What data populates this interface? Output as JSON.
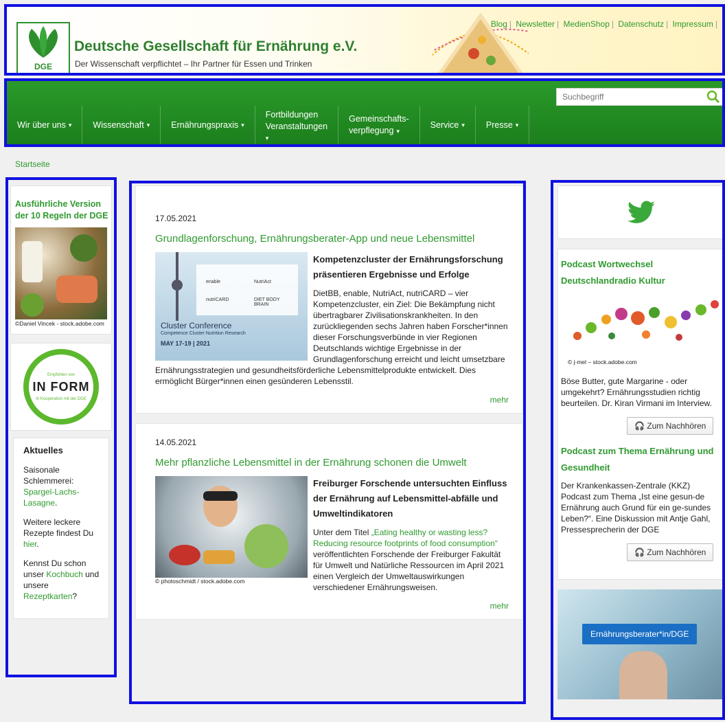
{
  "header": {
    "logo_text": "DGE",
    "title": "Deutsche Gesellschaft für Ernährung e.V.",
    "subtitle": "Der Wissenschaft verpflichtet – Ihr Partner für Essen und Trinken",
    "toplinks": [
      "Blog",
      "Newsletter",
      "MedienShop",
      "Datenschutz",
      "Impressum"
    ]
  },
  "nav": {
    "items": [
      {
        "l1": "Wir über uns",
        "l2": ""
      },
      {
        "l1": "Wissenschaft",
        "l2": ""
      },
      {
        "l1": "Ernährungspraxis",
        "l2": ""
      },
      {
        "l1": "Fortbildungen",
        "l2": "Veranstaltungen"
      },
      {
        "l1": "Gemeinschafts-",
        "l2": "verpflegung"
      },
      {
        "l1": "Service",
        "l2": ""
      },
      {
        "l1": "Presse",
        "l2": ""
      }
    ],
    "caret": "▾",
    "search_placeholder": "Suchbegriff"
  },
  "breadcrumb": "Startseite",
  "left": {
    "regeln_title": "Ausführliche Version der 10 Regeln der DGE",
    "regeln_credit": "©Daniel Vincek - stock.adobe.com",
    "inform": {
      "top": "Empfohlen von",
      "logo": "IN FORM",
      "bottom": "In Kooperation mit der DGE"
    },
    "aktuell": {
      "title": "Aktuelles",
      "p1_pre": "Saisonale Schlemmerei:",
      "p1_link": "Spargel-Lachs-Lasagne",
      "p1_post": ".",
      "p2_pre": "Weitere leckere Rezepte findest Du",
      "p2_link": "hier",
      "p2_post": ".",
      "p3_pre": "Kennst Du schon unser",
      "p3_link1": "Kochbuch",
      "p3_mid": "und unsere",
      "p3_link2": "Rezeptkarten",
      "p3_post": "?"
    }
  },
  "articles": [
    {
      "date": "17.05.2021",
      "title": "Grundlagenforschung, Ernährungsberater-App und neue Lebensmittel",
      "subtitle": "Kompetenzcluster der Ernährungsforschung präsentieren Ergebnisse und Erfolge",
      "text": "DietBB, enable, NutriAct, nutriCARD – vier Kompetenzcluster, ein Ziel: Die Bekämpfung nicht übertragbarer Zivilisationskrankheiten. In den zurückliegenden sechs Jahren haben Forscher*innen dieser Forschungsverbünde in vier Regionen Deutschlands wichtige Ergebnisse in der Grundlagenforschung erreicht und leicht umsetzbare Ernährungsstrategien und gesundheitsförderliche Lebensmittelprodukte entwickelt. Dies ermöglicht Bürger*innen einen gesünderen Lebensstil.",
      "image": {
        "title": "Cluster Conference",
        "sub": "Competence Cluster Nutrition Research",
        "date": "MAY 17-19 | 2021",
        "logo1": "enable",
        "logo2": "NutriAct",
        "logo3": "nutriCARD",
        "logo4": "DIET BODY BRAIN"
      },
      "more": "mehr"
    },
    {
      "date": "14.05.2021",
      "title": "Mehr pflanzliche Lebensmittel in der Ernährung schonen die Umwelt",
      "subtitle": "Freiburger Forschende untersuchten Einfluss der Ernährung auf Lebensmittel-abfälle und Umweltindikatoren",
      "text_pre": "Unter dem Titel ",
      "text_link": "„Eating healthy or wasting less? Reducing resource footprints of food consumption“",
      "text_post": " veröffentlichten Forschende der Freiburger Fakultät für Umwelt und Natürliche Ressourcen im April 2021 einen Vergleich der Umweltauswirkungen verschiedener Ernährungsweisen.",
      "image_credit": "© photoschmidt / stock.adobe.com",
      "more": "mehr"
    }
  ],
  "right": {
    "podcast1": {
      "title": "Podcast Wortwechsel Deutschlandradio Kultur",
      "credit": "© j-mel – stock.adobe.com",
      "text": "Böse Butter, gute Margarine - oder umgekehrt? Ernährungsstudien richtig beurteilen. Dr. Kiran Virmani im Interview.",
      "button": "Zum Nachhören"
    },
    "podcast2": {
      "title": "Podcast zum Thema Ernährung und Gesundheit",
      "text": "Der Krankenkassen-Zentrale (KKZ) Podcast zum Thema „Ist eine gesun-de Ernährung auch Grund für ein ge-sundes Leben?“. Eine Diskussion mit Antje Gahl, Pressesprecherin der DGE",
      "button": "Zum Nachhören"
    },
    "berater_button": "Ernährungsberater*in/DGE"
  },
  "colors": {
    "green": "#2f9a2f",
    "nav": "#1f8a1f",
    "highlight": "#1010e0"
  }
}
